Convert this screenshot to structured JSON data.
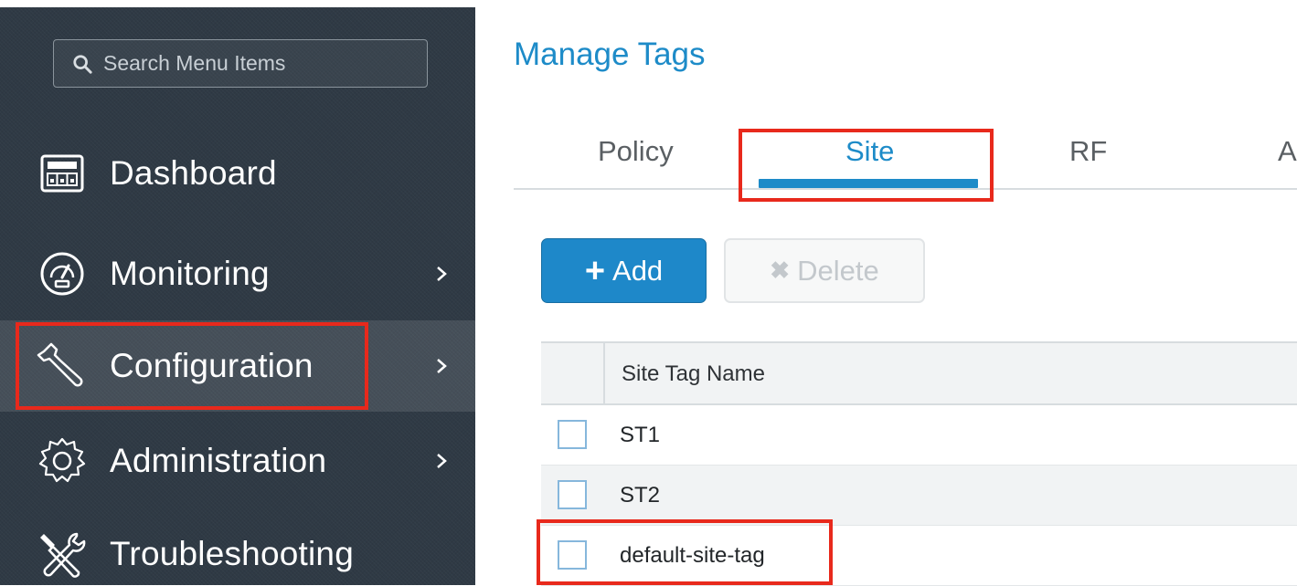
{
  "sidebar": {
    "search": {
      "placeholder": "Search Menu Items"
    },
    "items": [
      {
        "label": "Dashboard",
        "icon": "dashboard-icon",
        "has_submenu": false
      },
      {
        "label": "Monitoring",
        "icon": "gauge-icon",
        "has_submenu": true
      },
      {
        "label": "Configuration",
        "icon": "wrench-icon",
        "has_submenu": true,
        "active": true
      },
      {
        "label": "Administration",
        "icon": "gear-icon",
        "has_submenu": true
      },
      {
        "label": "Troubleshooting",
        "icon": "tools-icon",
        "has_submenu": false
      }
    ]
  },
  "main": {
    "title": "Manage Tags",
    "tabs": [
      {
        "label": "Policy"
      },
      {
        "label": "Site",
        "active": true
      },
      {
        "label": "RF"
      },
      {
        "label": "A"
      }
    ],
    "toolbar": {
      "add_icon": "+",
      "add_label": "Add",
      "delete_icon": "✖",
      "delete_label": "Delete"
    },
    "table": {
      "columns": [
        "Site Tag Name"
      ],
      "rows": [
        {
          "name": "ST1"
        },
        {
          "name": "ST2"
        },
        {
          "name": "default-site-tag"
        }
      ]
    }
  },
  "colors": {
    "accent": "#1d8bc8",
    "sidebar_bg": "#2f3a45",
    "highlight": "#e8291c"
  }
}
